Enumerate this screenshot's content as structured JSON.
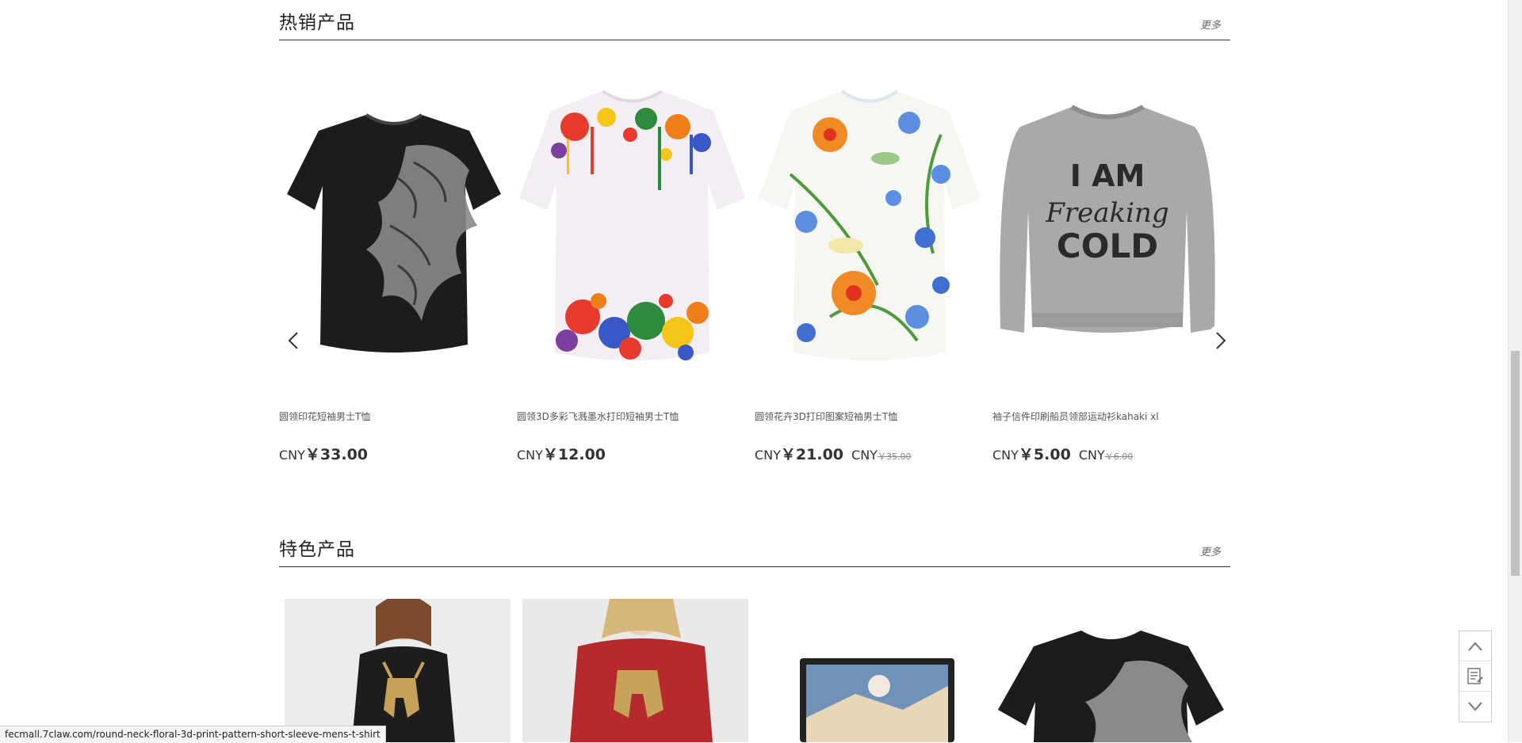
{
  "hot_section": {
    "title": "热销产品",
    "more_label": "更多",
    "products": [
      {
        "name": "圆领印花短袖男士T恤",
        "currency": "CNY",
        "price": "￥33.00",
        "image_icon": "black-lion-tshirt-image"
      },
      {
        "name": "圆领3D多彩飞溅墨水打印短袖男士T恤",
        "currency": "CNY",
        "price": "￥12.00",
        "image_icon": "paint-splatter-tshirt-image"
      },
      {
        "name": "圆领花卉3D打印图案短袖男士T恤",
        "currency": "CNY",
        "price": "￥21.00",
        "old_currency": "CNY",
        "old_price": "￥35.00",
        "image_icon": "floral-tshirt-image"
      },
      {
        "name": "袖子信件印刷船员领部运动衫kahaki xl",
        "currency": "CNY",
        "price": "￥5.00",
        "old_currency": "CNY",
        "old_price": "￥6.00",
        "image_icon": "grey-sweatshirt-image",
        "print_lines": [
          "I AM",
          "Freaking",
          "COLD"
        ]
      }
    ]
  },
  "featured_section": {
    "title": "特色产品",
    "more_label": "更多"
  },
  "status_bar": {
    "url": "fecmall.7claw.com/round-neck-floral-3d-print-pattern-short-sleeve-mens-t-shirt"
  },
  "colors": {
    "accent_text": "#333333",
    "divider": "#333333",
    "shirt_black": "#1c1c1c",
    "sweatshirt_grey": "#a9a9a9",
    "reindeer_gold": "#c8a25a",
    "red_sweater": "#b52a2a"
  }
}
